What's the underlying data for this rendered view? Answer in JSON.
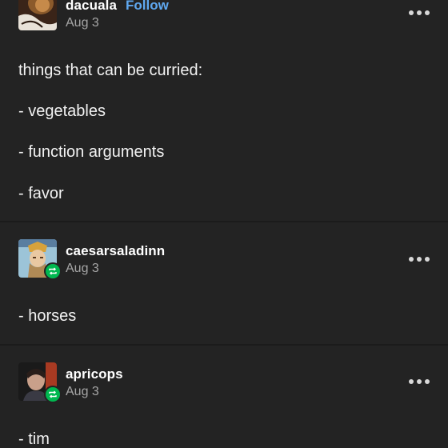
{
  "posts": [
    {
      "username": "dacuala",
      "follow_label": "Follow",
      "date": "Aug 3",
      "lines": [
        "things that can be curried:",
        "- vegetables",
        "- function arguments",
        "- favor"
      ]
    },
    {
      "username": "caesarsaladinn",
      "date": "Aug 3",
      "lines": [
        "- horses"
      ]
    },
    {
      "username": "apricops",
      "date": "Aug 3",
      "lines": [
        "- tim"
      ]
    }
  ],
  "icons": {
    "more": "more-options-icon",
    "reblog": "reblog-icon"
  },
  "colors": {
    "background": "#222222",
    "follow": "#5fa8f0",
    "reblog_badge": "#00b850",
    "muted_text": "#a6a6a6"
  }
}
